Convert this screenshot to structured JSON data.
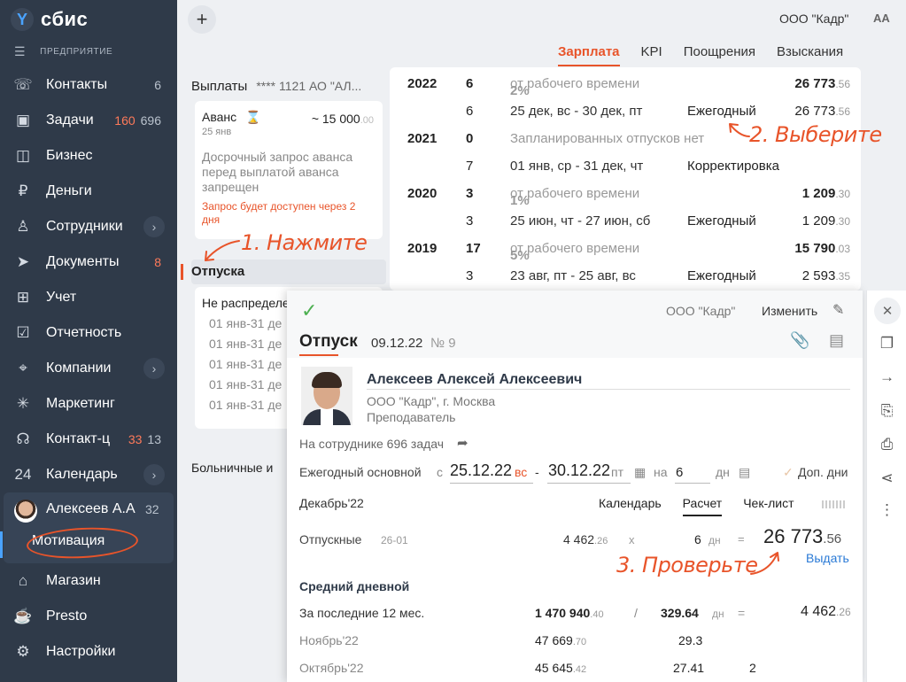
{
  "sidebar": {
    "logo_text": "сбис",
    "enterprise_label": "ПРЕДПРИЯТИЕ",
    "items": [
      {
        "label": "Контакты",
        "count": "6",
        "icon": "contacts-icon"
      },
      {
        "label": "Задачи",
        "count_red": "160",
        "count": "696",
        "icon": "tasks-icon"
      },
      {
        "label": "Бизнес",
        "icon": "business-icon"
      },
      {
        "label": "Деньги",
        "icon": "money-icon"
      },
      {
        "label": "Сотрудники",
        "icon": "employees-icon"
      },
      {
        "label": "Документы",
        "count_red": "8",
        "icon": "documents-icon"
      },
      {
        "label": "Учет",
        "icon": "accounting-icon"
      },
      {
        "label": "Отчетность",
        "icon": "reports-icon"
      },
      {
        "label": "Компании",
        "icon": "companies-icon"
      },
      {
        "label": "Маркетинг",
        "icon": "marketing-icon"
      },
      {
        "label": "Контакт-ц",
        "count_red": "33",
        "count": "13",
        "icon": "headset-icon"
      },
      {
        "label": "Календарь",
        "icon": "calendar-icon"
      },
      {
        "label": "Магазин",
        "icon": "shop-icon"
      },
      {
        "label": "Presto",
        "icon": "presto-icon"
      },
      {
        "label": "Настройки",
        "icon": "settings-icon"
      }
    ],
    "user": {
      "name": "Алексеев А.А",
      "count": "32",
      "sub": "Мотивация"
    }
  },
  "header": {
    "org": "ООО \"Кадр\"",
    "font_size_label": "AA",
    "tabs": [
      "Зарплата",
      "KPI",
      "Поощрения",
      "Взыскания"
    ]
  },
  "left": {
    "payments_label": "Выплаты",
    "account": "**** 1121  АО \"АЛ...",
    "advance": {
      "title": "Аванс",
      "amount_prefix": "~ 15 000",
      "amount_dec": ".00",
      "date": "25 янв",
      "note": "Досрочный запрос аванса перед выплатой аванса запрещен",
      "warn": "Запрос будет доступен через 2 дня"
    },
    "vacations_label": "Отпуска",
    "unassigned_title": "Не распределе",
    "unassigned_lines": [
      "01 янв-31 де",
      "01 янв-31 де",
      "01 янв-31 де",
      "01 янв-31 де",
      "01 янв-31 де"
    ],
    "sick_label": "Больничные и"
  },
  "table": {
    "rows": [
      {
        "year": "2022",
        "n": "6",
        "pct": "2%",
        "desc": "от рабочего времени",
        "type": "",
        "amt": "26 773",
        "dec": ".56",
        "bold": true
      },
      {
        "year": "",
        "n": "6",
        "pct": "",
        "desc": "25 дек, вс - 30 дек, пт",
        "type": "Ежегодный",
        "amt": "26 773",
        "dec": ".56",
        "bold": false
      },
      {
        "year": "2021",
        "n": "0",
        "pct": "",
        "desc": "Запланированных отпусков нет",
        "type": "",
        "amt": "",
        "dec": "",
        "bold": true
      },
      {
        "year": "",
        "n": "7",
        "pct": "",
        "desc": "01 янв, ср - 31 дек, чт",
        "type": "Корректировка",
        "amt": "",
        "dec": "",
        "bold": false
      },
      {
        "year": "2020",
        "n": "3",
        "pct": "1%",
        "desc": "от рабочего времени",
        "type": "",
        "amt": "1 209",
        "dec": ".30",
        "bold": true
      },
      {
        "year": "",
        "n": "3",
        "pct": "",
        "desc": "25 июн, чт - 27 июн, сб",
        "type": "Ежегодный",
        "amt": "1 209",
        "dec": ".30",
        "bold": false
      },
      {
        "year": "2019",
        "n": "17",
        "pct": "5%",
        "desc": "от рабочего времени",
        "type": "",
        "amt": "15 790",
        "dec": ".03",
        "bold": true
      },
      {
        "year": "",
        "n": "3",
        "pct": "",
        "desc": "23 авг, пт - 25 авг, вс",
        "type": "Ежегодный",
        "amt": "2 593",
        "dec": ".35",
        "bold": false
      }
    ]
  },
  "annotations": {
    "step1": "1. Нажмите",
    "step2": "2. Выберите",
    "step3": "3. Проверьте"
  },
  "panel": {
    "org": "ООО \"Кадр\"",
    "edit": "Изменить",
    "title": "Отпуск",
    "date": "09.12.22",
    "num": "№ 9",
    "employee_name": "Алексеев Алексей Алексеевич",
    "employee_org": "ООО \"Кадр\", г. Москва",
    "employee_pos": "Преподаватель",
    "tasks": "На сотруднике 696 задач",
    "vacation_type": "Ежегодный основной",
    "from_label": "с",
    "date_from": "25.12.22",
    "wd_from": "вс",
    "dash": "-",
    "date_to": "30.12.22",
    "wd_to": "пт",
    "na_label": "на",
    "days": "6",
    "days_unit": "дн",
    "extra_days": "Доп. дни",
    "month": "Декабрь'22",
    "subtabs": [
      "Календарь",
      "Расчет",
      "Чек-лист"
    ],
    "calc": {
      "label": "Отпускные",
      "code": "26-01",
      "avg": "4 462",
      "avg_dec": ".26",
      "x": "x",
      "n": "6",
      "n_unit": "дн",
      "eq": "=",
      "total": "26 773",
      "total_dec": ".56",
      "give": "Выдать"
    },
    "avg_header": "Средний дневной",
    "avg_rows": [
      {
        "label": "За последние 12 мес.",
        "sum": "1 470 940",
        "dec": ".40",
        "slash": "/",
        "days": "329.64",
        "unit": "дн",
        "eq": "=",
        "res": "4 462",
        "res_dec": ".26",
        "extra": ""
      },
      {
        "label": "Ноябрь'22",
        "sum": "47 669",
        "dec": ".70",
        "slash": "",
        "days": "29.3",
        "unit": "",
        "eq": "",
        "res": "",
        "res_dec": "",
        "extra": ""
      },
      {
        "label": "Октябрь'22",
        "sum": "45 645",
        "dec": ".42",
        "slash": "",
        "days": "27.41",
        "unit": "",
        "eq": "",
        "res": "",
        "res_dec": "",
        "extra": "2"
      }
    ]
  },
  "colors": {
    "accent": "#e8542a",
    "sidebar": "#2f3a49",
    "link": "#2a7ad6"
  }
}
